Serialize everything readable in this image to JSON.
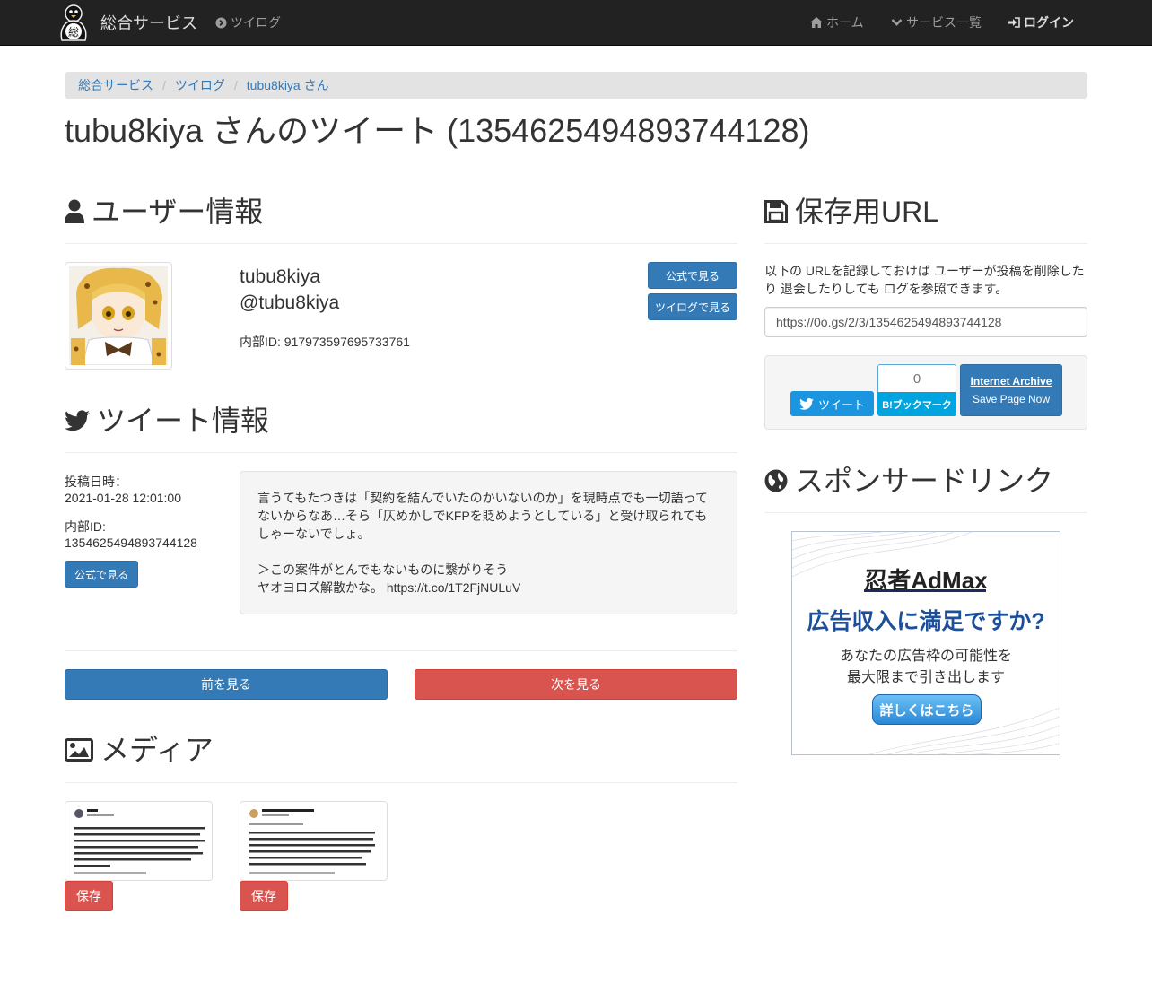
{
  "navbar": {
    "brand": "総合サービス",
    "logo_char": "総",
    "twilog_link": "ツイログ",
    "home": "ホーム",
    "services": "サービス一覧",
    "login": "ログイン"
  },
  "breadcrumb": [
    "総合サービス",
    "ツイログ",
    "tubu8kiya さん"
  ],
  "page_title": "tubu8kiya さんのツイート (1354625494893744128)",
  "user_section": {
    "heading": "ユーザー情報",
    "name": "tubu8kiya",
    "handle": "@tubu8kiya",
    "internal_id": "内部ID: 917973597695733761",
    "official_btn": "公式で見る",
    "twilog_btn": "ツイログで見る"
  },
  "tweet_section": {
    "heading": "ツイート情報",
    "posted_label": "投稿日時：",
    "posted_value": "2021-01-28 12:01:00",
    "id_label": "内部ID:",
    "id_value": "1354625494893744128",
    "official_btn": "公式で見る",
    "text_line1": "言うてもたつきは「契約を結んでいたのかいないのか」を現時点でも一切語ってないからなあ…そら「仄めかしでKFPを貶めようとしている」と受け取られてもしゃーないでしょ。",
    "text_line2": "＞この案件がとんでもないものに繋がりそう",
    "text_line3": "ヤオヨロズ解散かな。 https://t.co/1T2FjNULuV"
  },
  "pager": {
    "prev": "前を見る",
    "next": "次を見る"
  },
  "media_section": {
    "heading": "メディア",
    "save_btn": "保存"
  },
  "save_url_section": {
    "heading": "保存用URL",
    "description": "以下の URLを記録しておけば ユーザーが投稿を削除したり 退会したりしても ログを参照できます。",
    "url": "https://0o.gs/2/3/1354625494893744128",
    "tweet_btn": "ツイート",
    "hatena_count": "0",
    "hatena_btn": "B!ブックマーク",
    "ia_title": "Internet Archive",
    "ia_sub": "Save Page Now"
  },
  "sponsor_section": {
    "heading": "スポンサードリンク",
    "ad_brand": "忍者AdMax",
    "ad_headline": "広告収入に満足ですか?",
    "ad_line1": "あなたの広告枠の可能性を",
    "ad_line2": "最大限まで引き出します",
    "ad_cta": "詳しくはこちら"
  },
  "colors": {
    "navbar_bg": "#222222",
    "primary": "#337ab7",
    "danger": "#d9534f",
    "twitter": "#1b95e0",
    "hatena": "#00a4de"
  }
}
